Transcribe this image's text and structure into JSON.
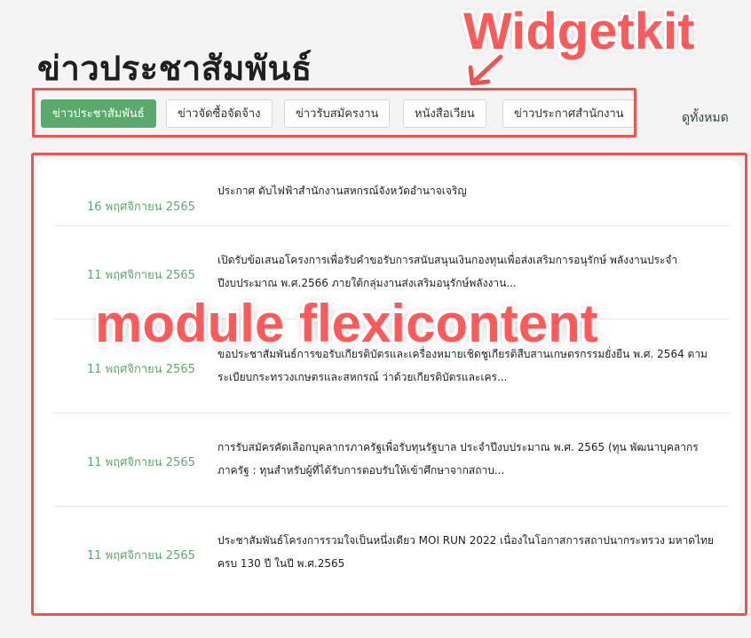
{
  "page_title": "ข่าวประชาสัมพันธ์",
  "annotations": {
    "widgetkit": "Widgetkit",
    "module": "module flexicontent",
    "color": "#ef5350"
  },
  "tabs": [
    {
      "label": "ข่าวประชาสัมพันธ์",
      "active": true
    },
    {
      "label": "ข่าวจัดซื้อจัดจ้าง",
      "active": false
    },
    {
      "label": "ข่าวรับสมัครงาน",
      "active": false
    },
    {
      "label": "หนังสือเวียน",
      "active": false
    },
    {
      "label": "ข่าวประกาศสำนักงาน",
      "active": false
    }
  ],
  "view_all": "ดูทั้งหมด",
  "accent_color": "#5aaa6e",
  "news": [
    {
      "date": "16 พฤศจิกายน 2565",
      "title": "ประกาศ ดับไฟฟ้าสำนักงานสหกรณ์จังหวัดอำนาจเจริญ"
    },
    {
      "date": "11 พฤศจิกายน 2565",
      "title": "เปิดรับข้อเสนอโครงการเพื่อรับคำขอรับการสนับสนุนเงินกองทุนเพื่อส่งเสริมการอนุรักษ์ พลังงานประจำปีงบประมาณ พ.ศ.2566 ภายใต้กลุ่มงานส่งเสริมอนุรักษ์พลังงาน..."
    },
    {
      "date": "11 พฤศจิกายน 2565",
      "title": "ขอประชาสัมพันธ์การขอรับเกียรติบัตรและเครื่องหมายเชิดชูเกียรติสืบสานเกษตรกรรมยั่งยืน พ.ศ. 2564 ตามระเบียบกระทรวงเกษตรและสหกรณ์ ว่าด้วยเกียรติบัตรและเคร..."
    },
    {
      "date": "11 พฤศจิกายน 2565",
      "title": "การรับสมัครคัดเลือกบุคลากรภาครัฐเพื่อรับทุนรัฐบาล ประจำปีงบประมาณ พ.ศ. 2565 (ทุน พัฒนาบุคลากรภาครัฐ : ทุนสำหรับผู้ที่ได้รับการตอบรับให้เข้าศึกษาจากสถาบ..."
    },
    {
      "date": "11 พฤศจิกายน 2565",
      "title": "ประชาสัมพันธ์โครงการรวมใจเป็นหนึ่งเดียว MOI RUN 2022 เนื่องในโอกาสการสถาปนากระทรวง มหาดไทยครบ 130 ปี ในปี พ.ศ.2565"
    }
  ]
}
